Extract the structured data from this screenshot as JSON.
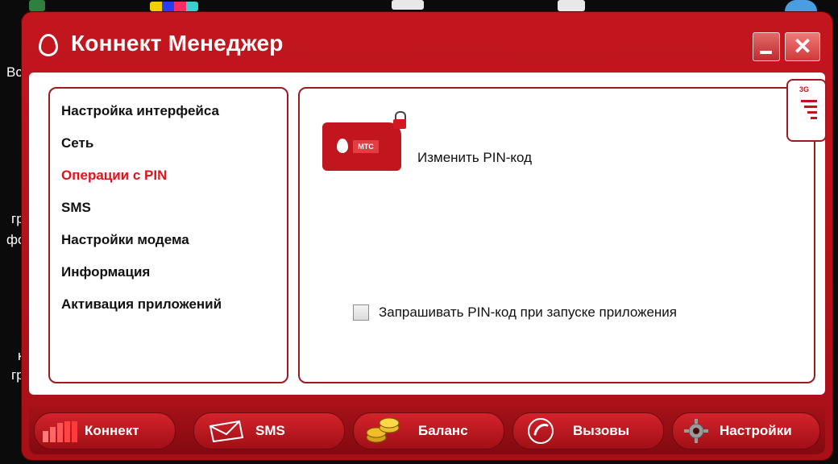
{
  "window": {
    "title": "Коннект Менеджер"
  },
  "desktop": {
    "fragments": [
      "Вс",
      "гр",
      "фо",
      "к",
      "гр"
    ]
  },
  "sidebar": {
    "items": [
      {
        "label": "Настройка интерфейса",
        "active": false
      },
      {
        "label": "Сеть",
        "active": false
      },
      {
        "label": "Операции с PIN",
        "active": true
      },
      {
        "label": "SMS",
        "active": false
      },
      {
        "label": "Настройки модема",
        "active": false
      },
      {
        "label": "Информация",
        "active": false
      },
      {
        "label": "Активация приложений",
        "active": false
      }
    ]
  },
  "main": {
    "change_pin_label": "Изменить PIN-код",
    "ask_pin_label": "Запрашивать PIN-код при запуске приложения",
    "ask_pin_checked": false,
    "sim_brand": "МТС",
    "network_tab": "3G"
  },
  "bottom_bar": {
    "connect": "Коннект",
    "sms": "SMS",
    "balance": "Баланс",
    "calls": "Вызовы",
    "settings": "Настройки"
  },
  "colors": {
    "brand_red": "#c2161e",
    "active_text": "#e0131b"
  }
}
